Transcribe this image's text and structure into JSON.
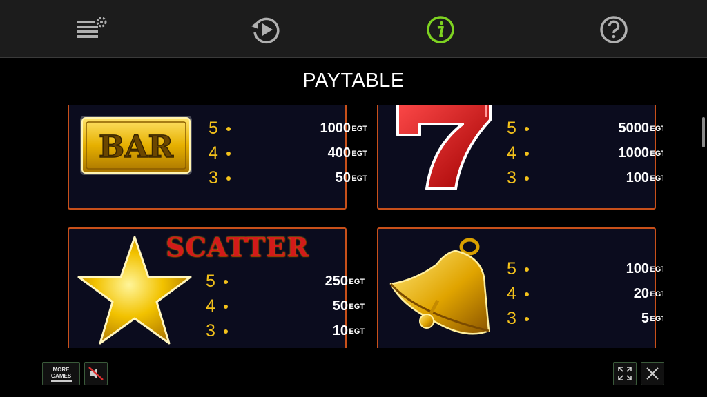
{
  "topbar": {
    "icons": [
      "bet-settings-icon",
      "autoplay-replay-icon",
      "info-icon",
      "help-icon"
    ],
    "active_color": "#7ed321",
    "icon_color": "#b0b0b0"
  },
  "title": "PAYTABLE",
  "currency": "EGT",
  "cards": [
    {
      "symbol": "bar-symbol",
      "symbol_text": "BAR",
      "payouts": [
        {
          "count": "5",
          "value": "1000"
        },
        {
          "count": "4",
          "value": "400"
        },
        {
          "count": "3",
          "value": "50"
        }
      ]
    },
    {
      "symbol": "seven-symbol",
      "payouts": [
        {
          "count": "5",
          "value": "5000"
        },
        {
          "count": "4",
          "value": "1000"
        },
        {
          "count": "3",
          "value": "100"
        }
      ]
    },
    {
      "symbol": "star-symbol",
      "label": "SCATTER",
      "payouts": [
        {
          "count": "5",
          "value": "250"
        },
        {
          "count": "4",
          "value": "50"
        },
        {
          "count": "3",
          "value": "10"
        }
      ]
    },
    {
      "symbol": "bell-symbol",
      "payouts": [
        {
          "count": "5",
          "value": "100"
        },
        {
          "count": "4",
          "value": "20"
        },
        {
          "count": "3",
          "value": "5"
        }
      ]
    }
  ],
  "footer": {
    "more_games_line1": "MORE",
    "more_games_line2": "GAMES"
  },
  "colors": {
    "card_border": "#c8501a",
    "card_bg": "#0b0c1e",
    "count_color": "#f4c21b"
  }
}
